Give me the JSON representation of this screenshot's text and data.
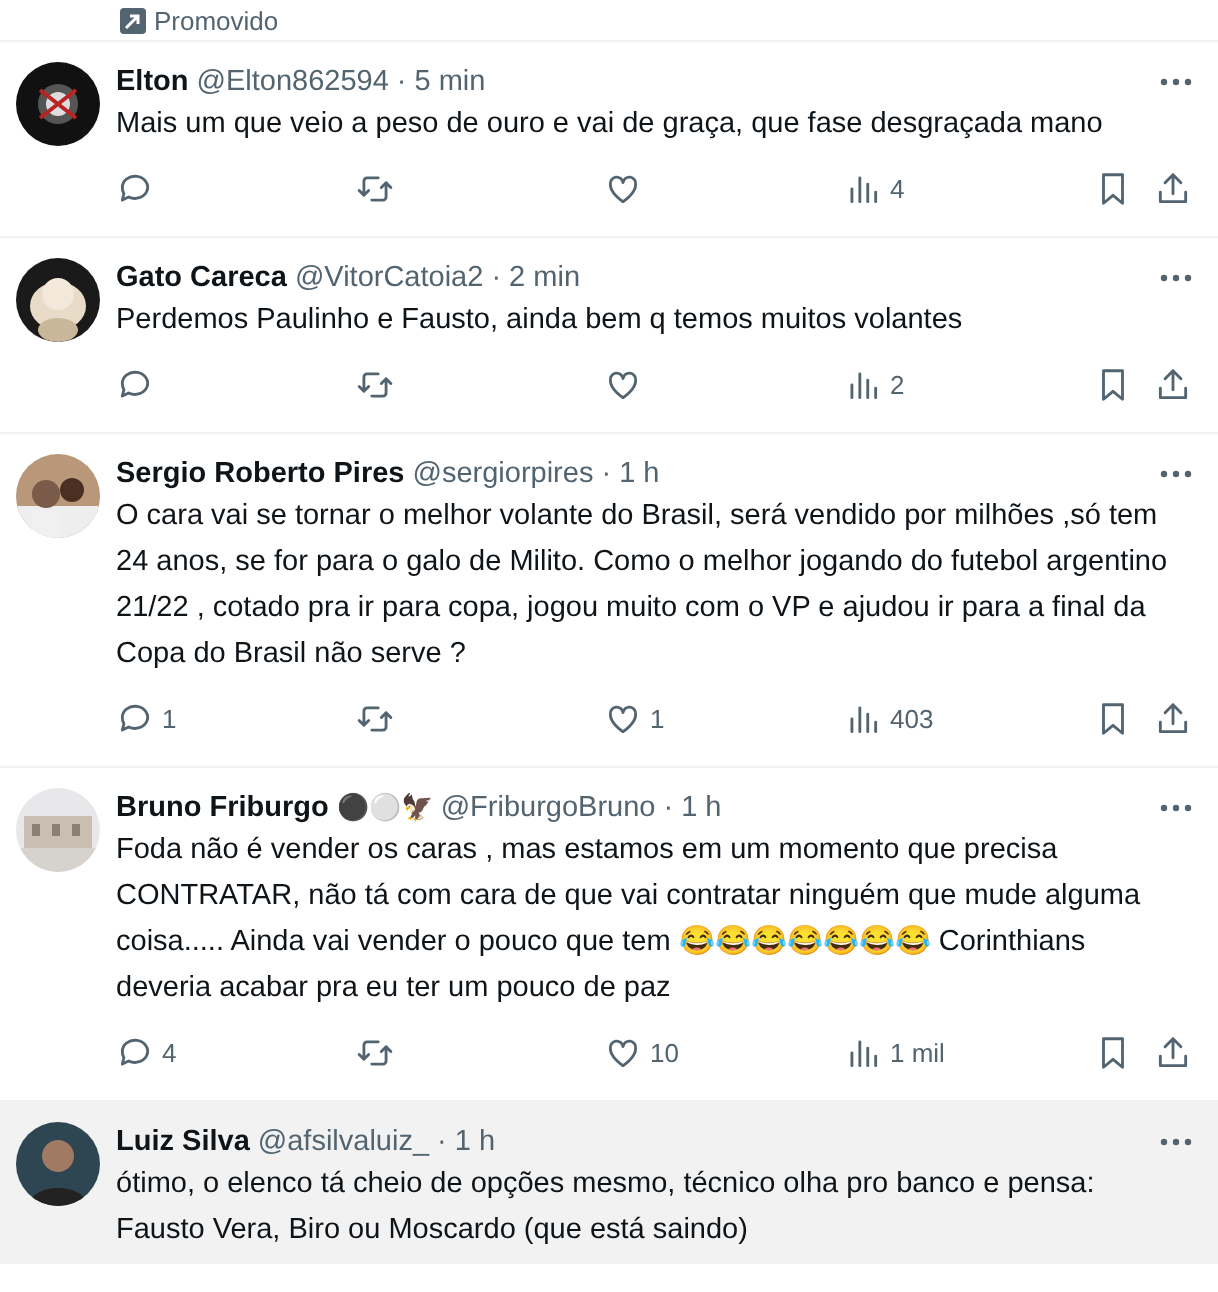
{
  "promo": {
    "label": "Promovido"
  },
  "tweets": [
    {
      "name": "Elton",
      "handle": "@Elton862594",
      "time": "· 5 min",
      "highlighted": false,
      "text": "Mais um que veio a peso de ouro e vai de graça, que fase desgraçada mano",
      "views": "4"
    },
    {
      "name": "Gato Careca",
      "handle": "@VitorCatoia2",
      "time": "· 2 min",
      "highlighted": false,
      "text": "Perdemos Paulinho e Fausto, ainda bem q temos muitos volantes",
      "views": "2"
    },
    {
      "name": "Sergio Roberto Pires",
      "handle": "@sergiorpires",
      "time": "· 1 h",
      "highlighted": false,
      "text": "O cara vai se tornar o melhor volante do Brasil, será vendido por milhões ,só tem 24 anos, se for para o galo de Milito. Como o melhor jogando do futebol argentino 21/22 , cotado pra ir para copa, jogou muito com o VP e ajudou ir para a final da Copa do Brasil não serve ?",
      "replies": "1",
      "likes": "1",
      "views": "403"
    },
    {
      "name": "Bruno Friburgo",
      "name_emoji": "⚫⚪🦅",
      "handle": "@FriburgoBruno",
      "time": "· 1 h",
      "highlighted": false,
      "text": "Foda não é vender os caras , mas estamos em um momento que precisa CONTRATAR, não tá com cara de que vai contratar ninguém que mude alguma coisa..... Ainda vai vender o pouco que tem 😂😂😂😂😂😂😂 Corinthians deveria acabar pra eu ter um pouco de paz",
      "replies": "4",
      "likes": "10",
      "views": "1 mil"
    },
    {
      "name": "Luiz Silva",
      "handle": "@afsilvaluiz_",
      "time": "· 1 h",
      "highlighted": true,
      "text": "ótimo, o elenco tá cheio de opções mesmo, técnico olha pro banco e pensa: Fausto Vera, Biro ou Moscardo (que está saindo)"
    }
  ]
}
